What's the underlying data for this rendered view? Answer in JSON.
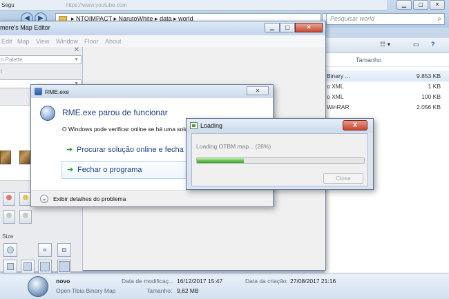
{
  "explorer": {
    "tab_text": "Segu",
    "tab_url": "https://www.youtube.com",
    "address_path": "▸ NTOIMPACT ▸ NarutoWhite ▸ data ▸ world",
    "search_placeholder": "Pesquisar world",
    "column_size": "Tamanho",
    "files": [
      {
        "type": "Binary ...",
        "size": "9.853 KB"
      },
      {
        "type": "o XML",
        "size": "1 KB"
      },
      {
        "type": "o XML",
        "size": "100 KB"
      },
      {
        "type": "WinRAR",
        "size": "2.056 KB"
      }
    ],
    "toolbar": {
      "views": "☷ ▾",
      "preview": "▭",
      "help": "?"
    }
  },
  "details_pane": {
    "file_name": "novo",
    "file_type": "Open Tibia Binary Map",
    "modified_label": "Data de modificaç...",
    "modified_value": "16/12/2017 15:47",
    "size_label": "Tamanho:",
    "size_value": "9,62 MB",
    "created_label": "Data da criação:",
    "created_value": "27/08/2017 21:16"
  },
  "editor": {
    "title": "mere's Map Editor",
    "menu": [
      "Edit",
      "Map",
      "View",
      "Window",
      "Floor",
      "About"
    ],
    "palette_label": "n Palette",
    "palette_sub": "t",
    "size_label": "Size"
  },
  "crash_dialog": {
    "title": "RME.exe",
    "close": "✕",
    "heading": "RME.exe parou de funcionar",
    "message": "O Windows pode verificar online se há uma solu",
    "option_online": "Procurar solução online e fecha",
    "option_close": "Fechar o programa",
    "details": "Exibir detalhes do problema"
  },
  "loading_dialog": {
    "title": "Loading",
    "close": "X",
    "message": "Loading OTBM map... (28%)",
    "progress": 0.28,
    "button": "Close"
  },
  "colors": {
    "progress_green": "#5fc24a",
    "link_blue": "#1c3f8a",
    "close_red": "#c5442c"
  }
}
